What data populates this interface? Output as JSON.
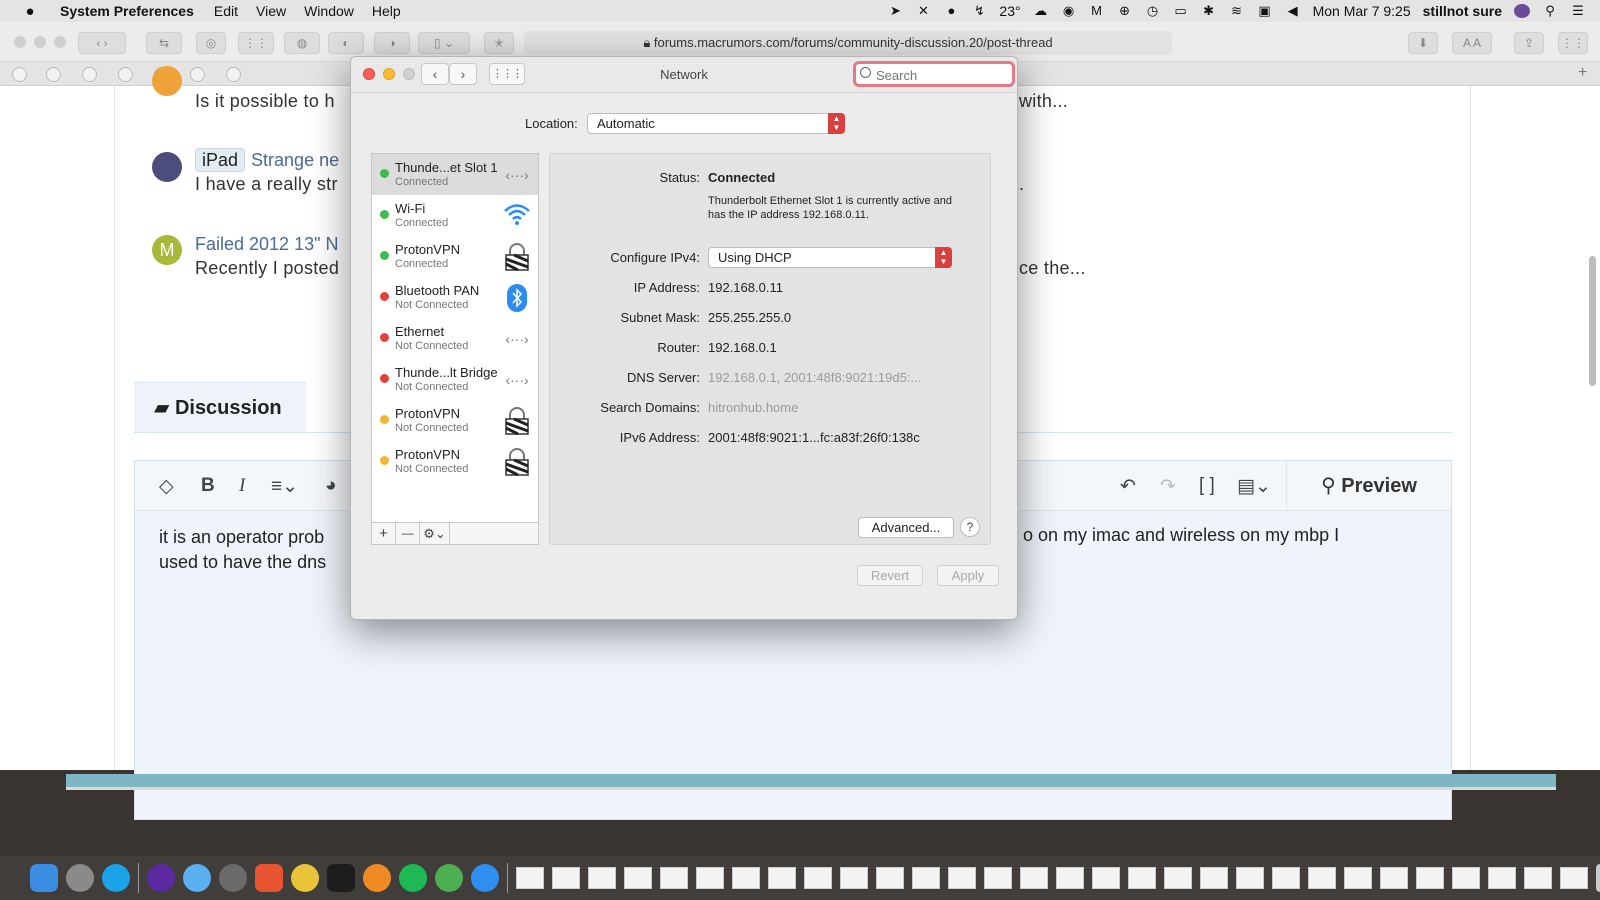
{
  "menubar": {
    "app": "System Preferences",
    "items": [
      "Edit",
      "View",
      "Window",
      "Help"
    ],
    "temperature": "23°",
    "datetime": "Mon Mar 7  9:25",
    "user": "stillnot sure"
  },
  "browser": {
    "url": "forums.macrumors.com/forums/community-discussion.20/post-thread",
    "threads": [
      {
        "avatar_letter": "",
        "title": "",
        "snippet": "Is it possible to h",
        "snippet_tail": "with..."
      },
      {
        "badge": "iPad",
        "title": "Strange ne",
        "snippet": "I have a really str",
        "snippet_tail": "."
      },
      {
        "avatar_letter": "M",
        "title": "Failed 2012 13\" N",
        "snippet": "Recently I posted",
        "snippet_tail": "ce the..."
      }
    ],
    "discussion_tab": "Discussion",
    "preview_label": "Preview",
    "editor_text_line1": "it is an operator prob",
    "editor_text_line2": "used to have the dns",
    "editor_text_right": "o on my imac and wireless on my mbp I"
  },
  "network": {
    "title": "Network",
    "search_placeholder": "Search",
    "location_label": "Location:",
    "location_value": "Automatic",
    "services": [
      {
        "name": "Thunde...et Slot 1",
        "state": "Connected",
        "color": "#3dbb4c",
        "icon": "ethernet-arrows-icon",
        "glyph": "‹···›"
      },
      {
        "name": "Wi-Fi",
        "state": "Connected",
        "color": "#3dbb4c",
        "icon": "wifi-icon",
        "glyph": "wifi"
      },
      {
        "name": "ProtonVPN",
        "state": "Connected",
        "color": "#3dbb4c",
        "icon": "vpn-lock-icon",
        "glyph": "lock"
      },
      {
        "name": "Bluetooth PAN",
        "state": "Not Connected",
        "color": "#e5413c",
        "icon": "bluetooth-icon",
        "glyph": "bt"
      },
      {
        "name": "Ethernet",
        "state": "Not Connected",
        "color": "#e5413c",
        "icon": "ethernet-arrows-icon",
        "glyph": "‹···›"
      },
      {
        "name": "Thunde...lt Bridge",
        "state": "Not Connected",
        "color": "#e5413c",
        "icon": "ethernet-arrows-icon",
        "glyph": "‹···›"
      },
      {
        "name": "ProtonVPN",
        "state": "Not Connected",
        "color": "#f2b630",
        "icon": "vpn-lock-icon",
        "glyph": "lock"
      },
      {
        "name": "ProtonVPN",
        "state": "Not Connected",
        "color": "#f2b630",
        "icon": "vpn-lock-icon",
        "glyph": "lock"
      }
    ],
    "list_tools": {
      "add": "+",
      "remove": "—",
      "action": "⚙⌄"
    },
    "status_label": "Status:",
    "status_value": "Connected",
    "status_desc": "Thunderbolt Ethernet Slot 1 is currently active and has the IP address 192.168.0.11.",
    "configure_label": "Configure IPv4:",
    "configure_value": "Using DHCP",
    "ip_label": "IP Address:",
    "ip_value": "192.168.0.11",
    "subnet_label": "Subnet Mask:",
    "subnet_value": "255.255.255.0",
    "router_label": "Router:",
    "router_value": "192.168.0.1",
    "dns_label": "DNS Server:",
    "dns_value": "192.168.0.1, 2001:48f8:9021:19d5:...",
    "search_domains_label": "Search Domains:",
    "search_domains_value": "hitronhub.home",
    "ipv6_label": "IPv6 Address:",
    "ipv6_value": "2001:48f8:9021:1...fc:a83f:26f0:138c",
    "advanced_label": "Advanced...",
    "help_label": "?",
    "revert_label": "Revert",
    "apply_label": "Apply"
  }
}
